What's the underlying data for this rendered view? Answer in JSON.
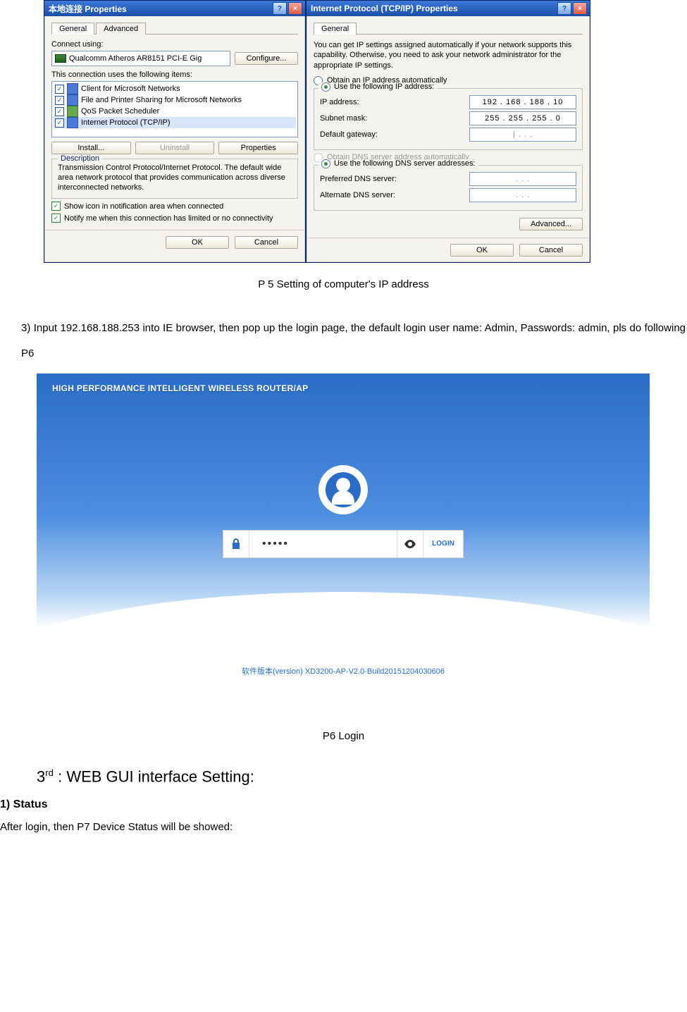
{
  "dialog1": {
    "title": "本地连接 Properties",
    "tabs": [
      "General",
      "Advanced"
    ],
    "connect_using_label": "Connect using:",
    "adapter": "Qualcomm Atheros AR8151 PCI-E Gig",
    "configure_btn": "Configure...",
    "items_label": "This connection uses the following items:",
    "items": [
      "Client for Microsoft Networks",
      "File and Printer Sharing for Microsoft Networks",
      "QoS Packet Scheduler",
      "Internet Protocol (TCP/IP)"
    ],
    "install_btn": "Install...",
    "uninstall_btn": "Uninstall",
    "properties_btn": "Properties",
    "desc_title": "Description",
    "desc_text": "Transmission Control Protocol/Internet Protocol. The default wide area network protocol that provides communication across diverse interconnected networks.",
    "chk1": "Show icon in notification area when connected",
    "chk2": "Notify me when this connection has limited or no connectivity",
    "ok": "OK",
    "cancel": "Cancel"
  },
  "dialog2": {
    "title": "Internet Protocol (TCP/IP) Properties",
    "tab": "General",
    "intro": "You can get IP settings assigned automatically if your network supports this capability. Otherwise, you need to ask your network administrator for the appropriate IP settings.",
    "radio_auto_ip": "Obtain an IP address automatically",
    "radio_use_ip": "Use the following IP address:",
    "ip_label": "IP address:",
    "ip_value": "192 . 168 . 188 .  10",
    "subnet_label": "Subnet mask:",
    "subnet_value": "255 . 255 . 255 .   0",
    "gateway_label": "Default gateway:",
    "gateway_value": "|      .        .        .",
    "radio_auto_dns": "Obtain DNS server address automatically",
    "radio_use_dns": "Use the following DNS server addresses:",
    "pref_dns_label": "Preferred DNS server:",
    "pref_dns_value": ".        .        .",
    "alt_dns_label": "Alternate DNS server:",
    "alt_dns_value": ".        .        .",
    "advanced_btn": "Advanced...",
    "ok": "OK",
    "cancel": "Cancel"
  },
  "captions": {
    "p5": "P 5    Setting of computer's IP address",
    "p6": "P6 Login"
  },
  "body": {
    "step3": "3) Input 192.168.188.253 into IE browser, then pop up the login page, the default login user name: Admin, Passwords: admin, pls do following P6"
  },
  "login": {
    "header": "HIGH PERFORMANCE INTELLIGENT WIRELESS ROUTER/AP",
    "password_mask": "•••••",
    "login_btn": "LOGIN",
    "footer": "软件版本(version) XD3200-AP-V2.0-Build20151204030606"
  },
  "section": {
    "heading_prefix": "3",
    "heading_suffix": "rd",
    "heading_rest": " : WEB GUI interface Setting:",
    "sub1": "1) Status",
    "sub1_text": "After login, then P7 Device Status will be showed:"
  }
}
